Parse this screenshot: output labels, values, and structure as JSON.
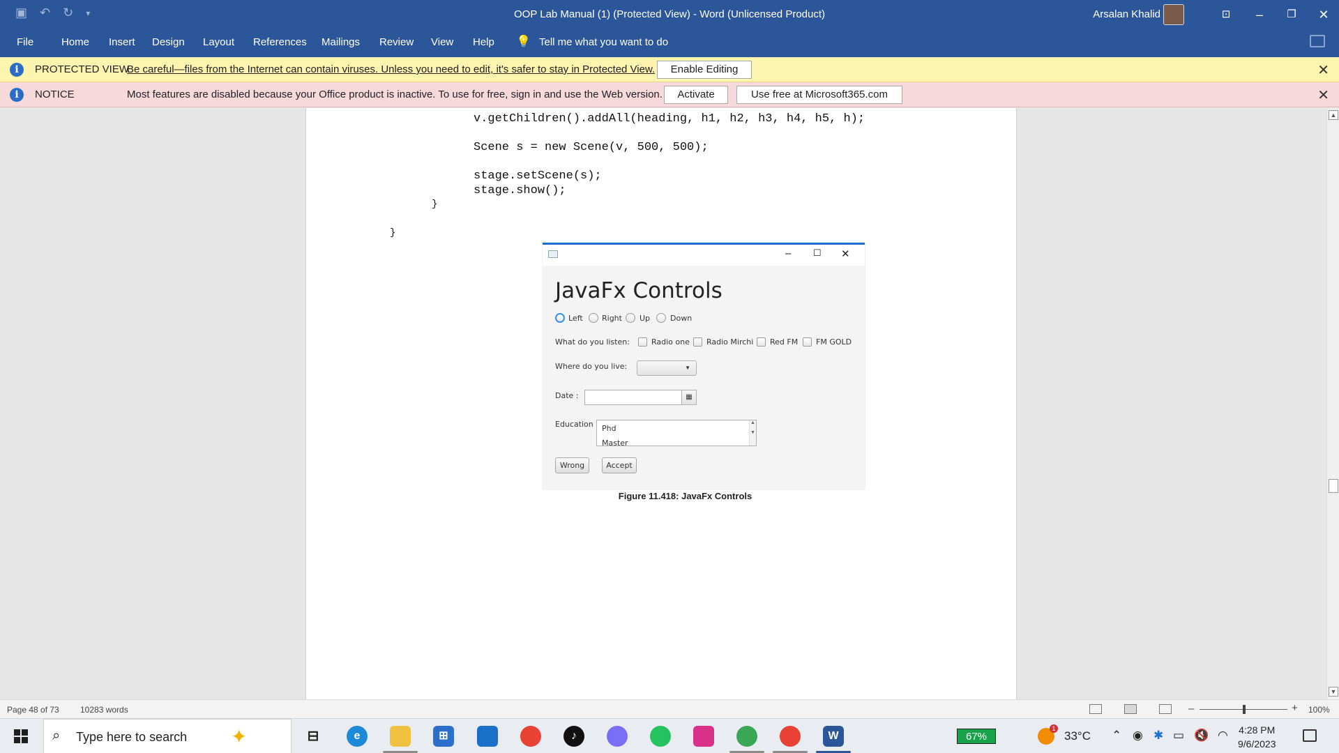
{
  "titlebar": {
    "doc_title": "OOP Lab Manual (1) (Protected View)  -  Word (Unlicensed Product)",
    "user_name": "Arsalan Khalid"
  },
  "menu": {
    "tabs": [
      "File",
      "Home",
      "Insert",
      "Design",
      "Layout",
      "References",
      "Mailings",
      "Review",
      "View",
      "Help"
    ],
    "tell_me": "Tell me what you want to do"
  },
  "protected_bar": {
    "title": "PROTECTED VIEW",
    "message": "Be careful—files from the Internet can contain viruses. Unless you need to edit, it's safer to stay in Protected View.",
    "button": "Enable Editing"
  },
  "notice_bar": {
    "title": "NOTICE",
    "message": "Most features are disabled because your Office product is inactive. To use for free, sign in and use the Web version.",
    "button1": "Activate",
    "button2": "Use free at Microsoft365.com"
  },
  "code_lines": [
    "v.getChildren().addAll(heading, h1, h2, h3, h4, h5, h);",
    "Scene s = new Scene(v, 500, 500);",
    "stage.setScene(s);",
    "stage.show();",
    "}",
    "}"
  ],
  "javafx_window": {
    "heading": "JavaFx Controls",
    "radios": [
      "Left",
      "Right",
      "Up",
      "Down"
    ],
    "listen_label": "What do you listen:",
    "checkboxes": [
      "Radio one",
      "Radio Mirchi",
      "Red FM",
      "FM GOLD"
    ],
    "live_label": "Where do you live:",
    "date_label": "Date :",
    "education_label": "Education",
    "education_items": [
      "Phd",
      "Master"
    ],
    "buttons": [
      "Wrong",
      "Accept"
    ]
  },
  "caption": "Figure 11.418: JavaFx Controls",
  "statusbar": {
    "page": "Page 48 of 73",
    "words": "10283 words",
    "zoom": "100%"
  },
  "taskbar": {
    "search_placeholder": "Type here to search",
    "battery": "67%",
    "temperature": "33°C",
    "time": "4:28 PM",
    "date": "9/6/2023",
    "weather_badge": "1"
  }
}
